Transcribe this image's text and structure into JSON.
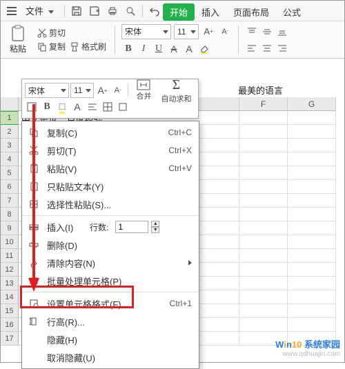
{
  "titlebar": {
    "menu_label": "文件"
  },
  "tabs": {
    "start": "开始",
    "insert": "插入",
    "page_layout": "页面布局",
    "formulas": "公式"
  },
  "ribbon": {
    "paste": "粘贴",
    "cut": "剪切",
    "copy": "复制",
    "format_painter": "格式刷",
    "font_name": "宋体",
    "font_size": "11",
    "merge": "合并",
    "autosum": "自动求和"
  },
  "mini_toolbar": {
    "font_name": "宋体",
    "font_size": "11",
    "merge": "合并",
    "autosum": "自动求和"
  },
  "formula_bar": {
    "text1": "中文是世",
    "text2": "百度经验"
  },
  "cell_header_text": "最美的语言",
  "columns": {
    "F": "F",
    "G": "G"
  },
  "rows": [
    "1",
    "2",
    "3",
    "4",
    "5",
    "6",
    "7",
    "8",
    "9",
    "10",
    "11",
    "12",
    "13",
    "14",
    "15",
    "16",
    "17"
  ],
  "context_menu": {
    "copy": "复制(C)",
    "copy_shortcut": "Ctrl+C",
    "cut": "剪切(T)",
    "cut_shortcut": "Ctrl+X",
    "paste": "粘贴(V)",
    "paste_shortcut": "Ctrl+V",
    "paste_text": "只粘贴文本(Y)",
    "paste_special": "选择性粘贴(S)...",
    "insert": "插入(I)",
    "rows_label": "行数:",
    "rows_value": "1",
    "delete": "删除(D)",
    "clear": "清除内容(N)",
    "batch": "批量处理单元格(P)",
    "format_cells": "设置单元格格式(F)...",
    "format_cells_shortcut": "Ctrl+1",
    "row_height": "行高(R)...",
    "hide": "隐藏(H)",
    "unhide": "取消隐藏(U)"
  },
  "watermark": {
    "line1_w": "W",
    "line1_i": "i",
    "line1_n": "n",
    "line1_ten": "10",
    "line1_rest": "系统家园",
    "line2": "www.qdhuajin.com"
  }
}
